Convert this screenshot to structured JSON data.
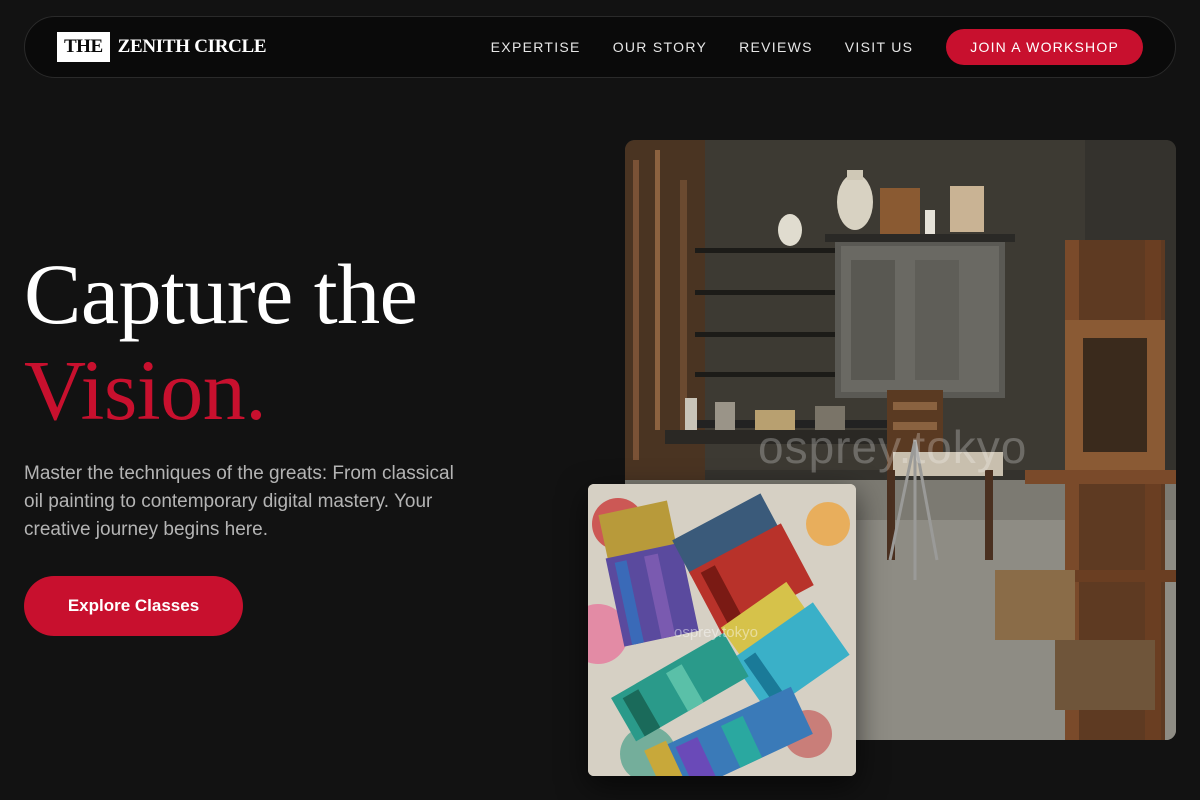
{
  "brand": {
    "box_text": "THE",
    "name": "ZENITH CIRCLE"
  },
  "nav": {
    "links": [
      "EXPERTISE",
      "OUR STORY",
      "REVIEWS",
      "VISIT US"
    ],
    "cta_label": "JOIN A WORKSHOP"
  },
  "hero": {
    "title_line1": "Capture the",
    "title_line2": "Vision.",
    "subtitle": "Master the techniques of the greats: From classical oil painting to contemporary digital mastery. Your creative journey begins here.",
    "cta_label": "Explore Classes"
  },
  "images": {
    "watermark": "osprey.tokyo",
    "studio_image": "art-studio-photo",
    "brushes_image": "paint-brushes-photo"
  },
  "colors": {
    "background": "#121212",
    "accent": "#c8102e",
    "text_primary": "#ffffff",
    "text_muted": "#b4b4b4"
  }
}
